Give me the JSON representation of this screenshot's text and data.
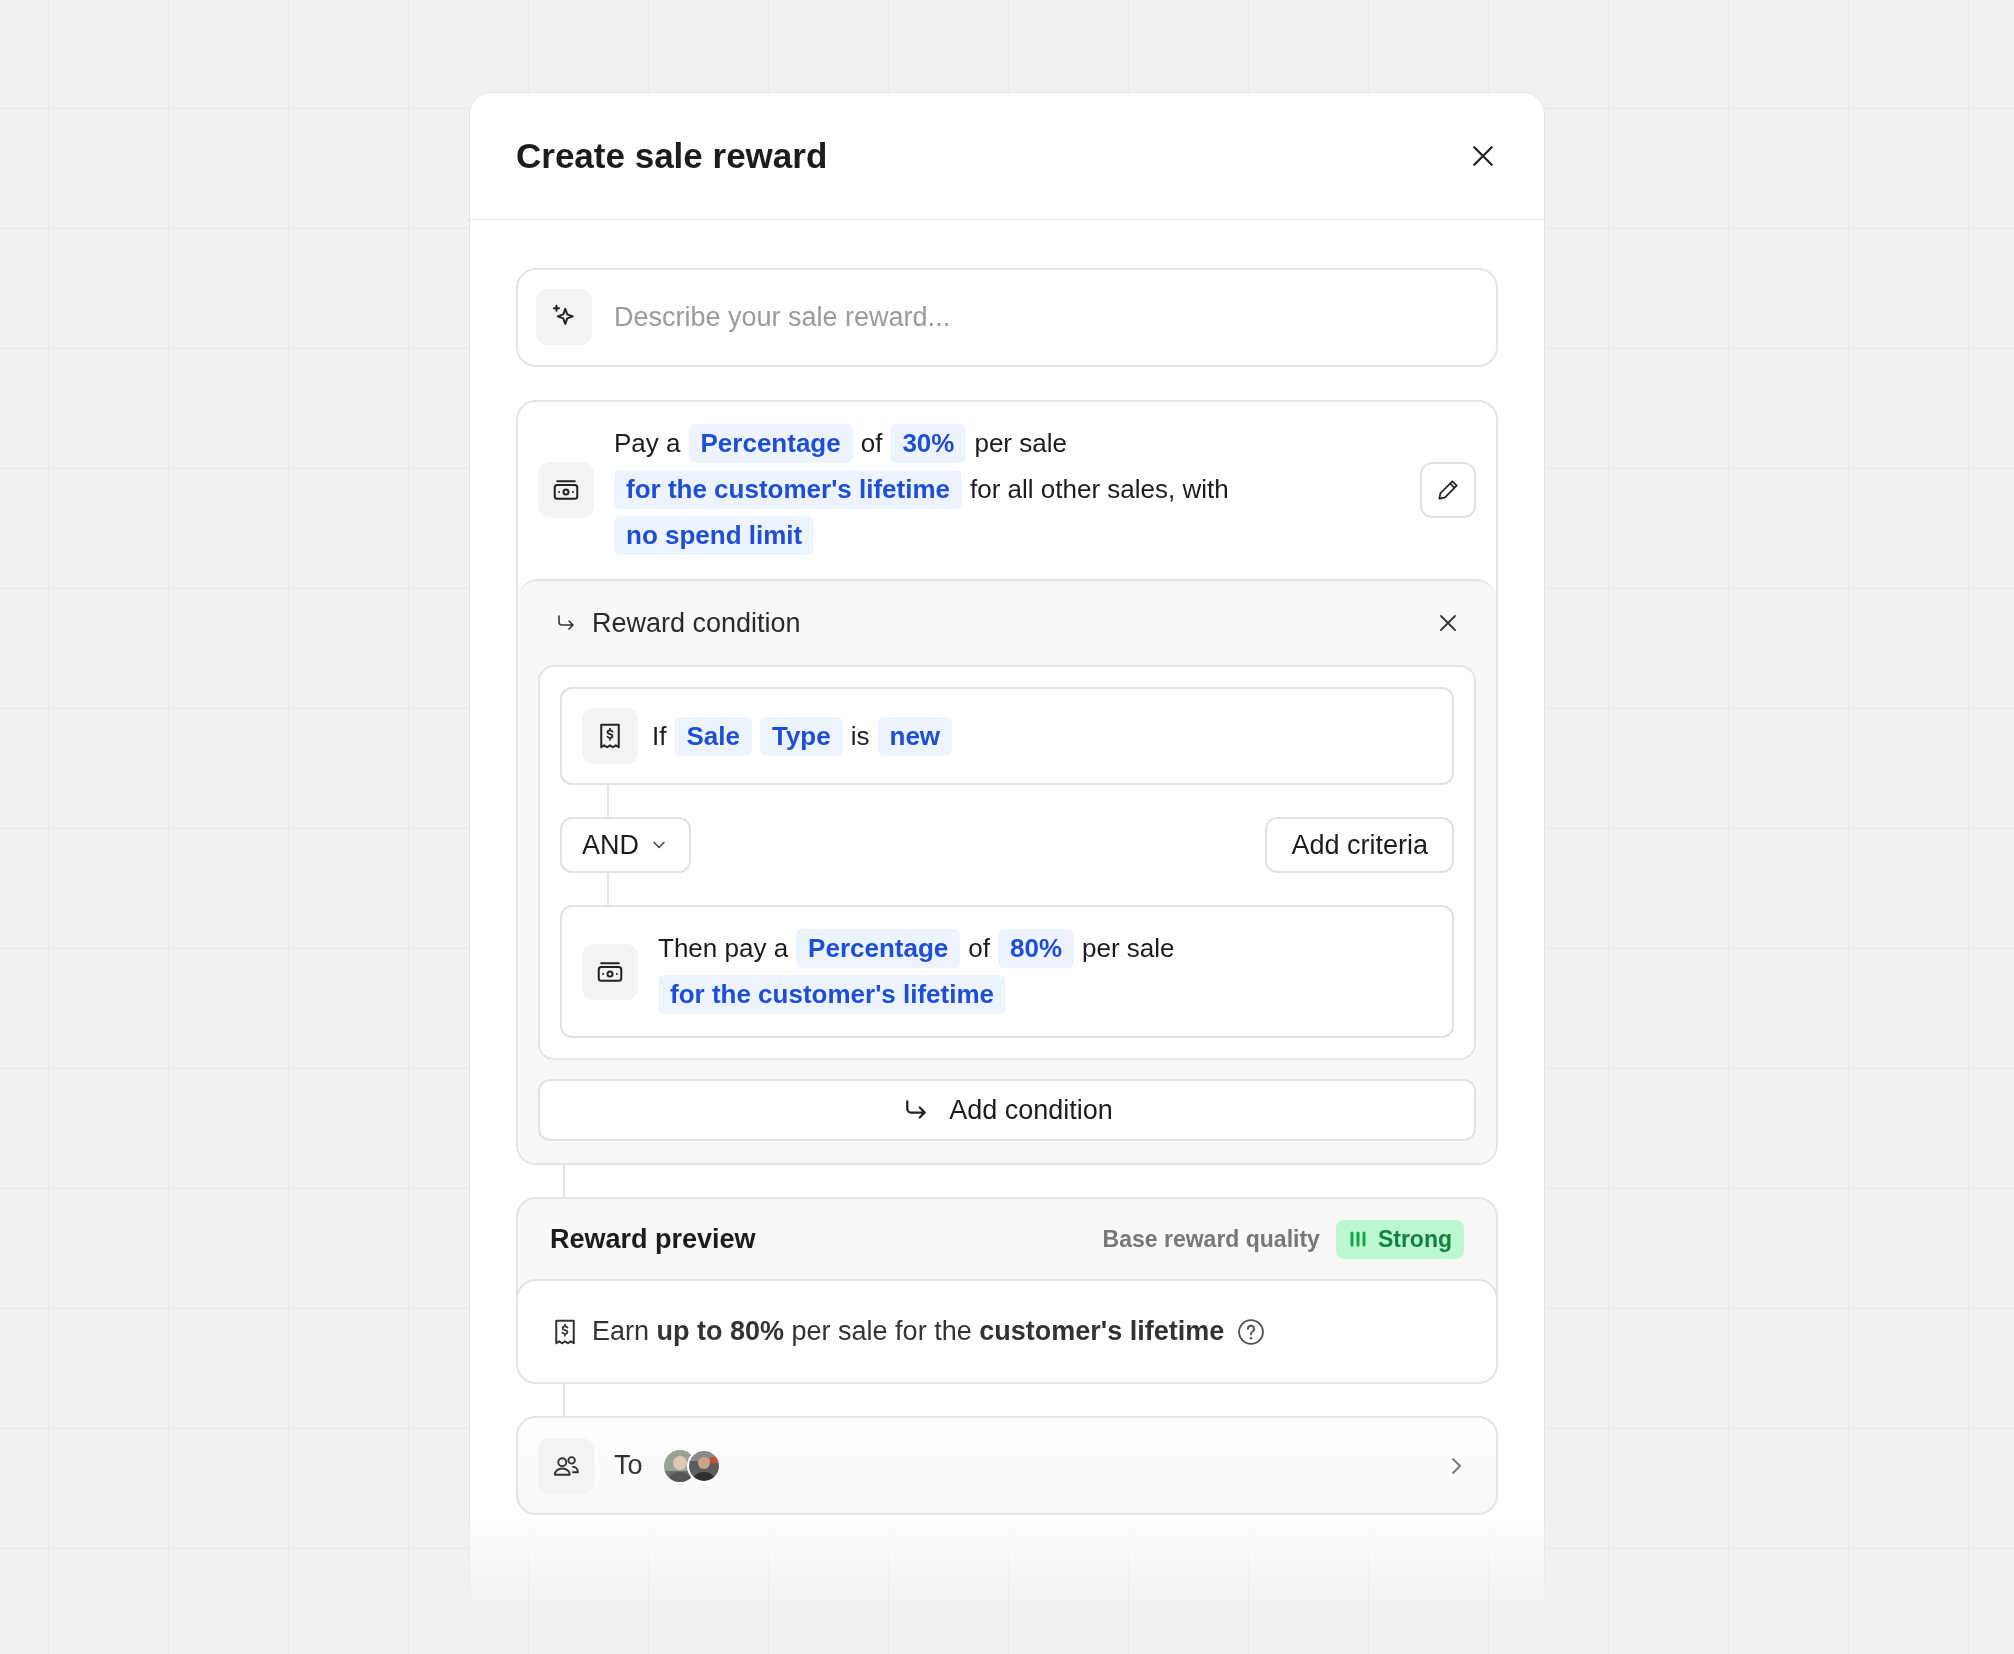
{
  "dialog": {
    "title": "Create sale reward"
  },
  "prompt": {
    "placeholder": "Describe your sale reward..."
  },
  "reward": {
    "sentence": [
      {
        "kind": "text",
        "text": "Pay a"
      },
      {
        "kind": "token",
        "text": "Percentage"
      },
      {
        "kind": "text",
        "text": "of"
      },
      {
        "kind": "token",
        "text": "30%"
      },
      {
        "kind": "text",
        "text": "per sale"
      },
      {
        "kind": "token",
        "text": "for the customer's lifetime"
      },
      {
        "kind": "text",
        "text": "for all other sales, with"
      },
      {
        "kind": "token",
        "text": "no spend limit"
      }
    ]
  },
  "condition": {
    "title": "Reward condition",
    "if": [
      {
        "kind": "text",
        "text": "If"
      },
      {
        "kind": "token",
        "text": "Sale"
      },
      {
        "kind": "token",
        "text": "Type"
      },
      {
        "kind": "text",
        "text": "is"
      },
      {
        "kind": "token",
        "text": "new"
      }
    ],
    "operator": "AND",
    "add_criteria": "Add criteria",
    "then": [
      {
        "kind": "text",
        "text": "Then pay a"
      },
      {
        "kind": "token",
        "text": "Percentage"
      },
      {
        "kind": "text",
        "text": "of"
      },
      {
        "kind": "token",
        "text": "80%"
      },
      {
        "kind": "text",
        "text": "per sale"
      },
      {
        "kind": "token",
        "text": "for the customer's lifetime"
      }
    ]
  },
  "add_condition": "Add condition",
  "preview": {
    "title": "Reward preview",
    "quality_label": "Base reward quality",
    "quality": "Strong",
    "summary": "Earn **up to 80%** per sale for the **customer's lifetime**"
  },
  "recipients": {
    "label": "To"
  }
}
